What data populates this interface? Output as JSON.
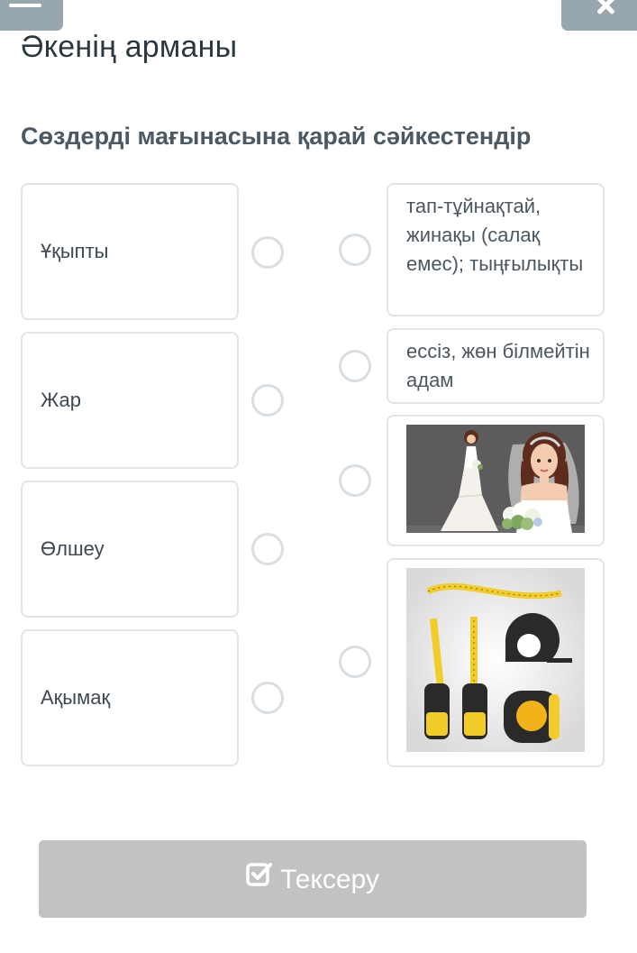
{
  "header": {
    "title": "Әкенің арманы",
    "menu_icon": "hamburger-icon",
    "close_icon": "close-icon"
  },
  "task": {
    "instruction": "Сөздерді мағынасына қарай сәйкестендір"
  },
  "left_items": [
    {
      "label": "Ұқыпты"
    },
    {
      "label": "Жар"
    },
    {
      "label": "Өлшеу"
    },
    {
      "label": "Ақымақ"
    }
  ],
  "right_items": [
    {
      "type": "text",
      "label": "тап-тұйнақтай, жинақы (салақ емес); тыңғылықты"
    },
    {
      "type": "text",
      "label": "ессіз, жөн білмейтін адам"
    },
    {
      "type": "image",
      "image": "bride-illustration"
    },
    {
      "type": "image",
      "image": "tape-measures-illustration"
    }
  ],
  "footer": {
    "check_label": "Тексеру",
    "check_icon": "checkbox-check-icon"
  },
  "colors": {
    "button_gray": "#c2c2c2",
    "top_button": "#98a6ae",
    "card_border": "#e1e5e8",
    "radio_border": "#d8dee2",
    "text_dark": "#2c3840"
  }
}
